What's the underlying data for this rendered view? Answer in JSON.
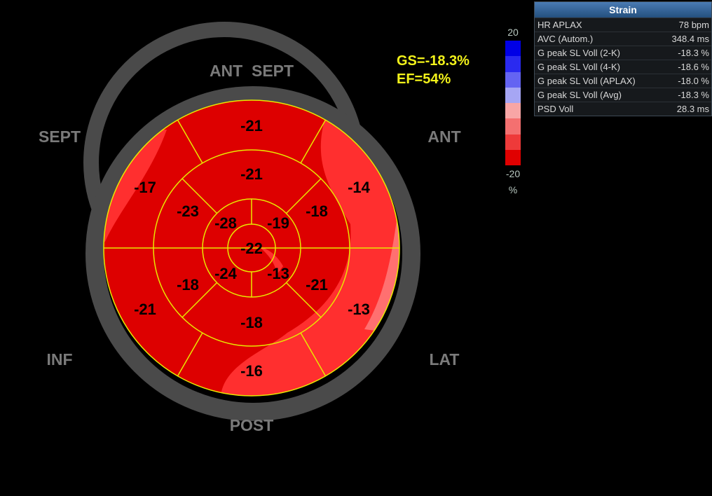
{
  "summary": {
    "gs": "GS=-18.3%",
    "ef": "EF=54%"
  },
  "view_labels": {
    "ant_sept": "ANT  SEPT",
    "ant": "ANT",
    "sept": "SEPT",
    "inf": "INF",
    "lat": "LAT",
    "post": "POST"
  },
  "segments": {
    "outer": [
      "-21",
      "-14",
      "-13",
      "-16",
      "-21",
      "-17"
    ],
    "middle": [
      "-21",
      "-18",
      "-21",
      "-18",
      "-18",
      "-23"
    ],
    "inner": [
      "-19",
      "-13",
      "-24",
      "-28"
    ],
    "apex": "-22"
  },
  "color_scale": {
    "max_label": "20",
    "min_label": "-20",
    "unit": "%",
    "colors": [
      "#0000e6",
      "#2a2af0",
      "#6464f2",
      "#a6a6f4",
      "#f8a6a6",
      "#f47070",
      "#ee3a3a",
      "#e00000"
    ]
  },
  "map_colors": {
    "base": "#dd0000",
    "light": "#ff2f2f",
    "pale": "#ff7070",
    "ring": "#4a4a4a",
    "grid": "#e8e800"
  },
  "strain_panel": {
    "title": "Strain",
    "rows": [
      {
        "label": "HR APLAX",
        "value": "78 bpm"
      },
      {
        "label": "AVC (Autom.)",
        "value": "348.4 ms"
      },
      {
        "label": "G peak SL Voll (2-K)",
        "value": "-18.3 %"
      },
      {
        "label": "G peak SL Voll (4-K)",
        "value": "-18.6 %"
      },
      {
        "label": "G peak SL Voll (APLAX)",
        "value": "-18.0 %"
      },
      {
        "label": "G peak SL Voll (Avg)",
        "value": "-18.3 %"
      },
      {
        "label": "PSD Voll",
        "value": "28.3 ms"
      }
    ]
  }
}
